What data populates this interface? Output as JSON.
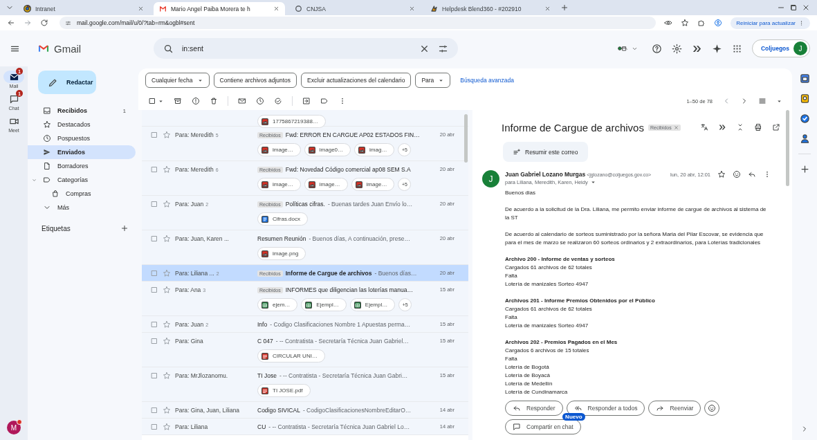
{
  "browser": {
    "tabs": [
      {
        "title": "Intranet",
        "kind": "tricolor",
        "selected": false
      },
      {
        "title": "Mario Angel Paiba Morera te h",
        "kind": "mail",
        "selected": true
      },
      {
        "title": "CNJSA",
        "kind": "ring",
        "selected": false
      },
      {
        "title": "Helpdesk Blend360 - #202910",
        "kind": "spark",
        "selected": false
      }
    ],
    "address": "mail.google.com/mail/u/0/?tab=rm&ogbl#sent",
    "update_button": "Reiniciar para actualizar"
  },
  "header": {
    "logo": "Gmail",
    "search": {
      "value": "in:sent"
    },
    "account": {
      "label": "Coljuegos",
      "initial": "J"
    }
  },
  "rail": [
    {
      "label": "Mail",
      "kind": "mail",
      "badge": "1",
      "selected": true
    },
    {
      "label": "Chat",
      "kind": "chat",
      "badge": "1",
      "selected": false
    },
    {
      "label": "Meet",
      "kind": "video",
      "selected": false
    }
  ],
  "profile": {
    "initial": "M"
  },
  "compose": "Redactar",
  "nav": [
    {
      "label": "Recibidos",
      "kind": "inbox",
      "count": "1",
      "unread": true,
      "selected": false
    },
    {
      "label": "Destacados",
      "kind": "star",
      "unread": false,
      "selected": false
    },
    {
      "label": "Pospuestos",
      "kind": "clock",
      "unread": false,
      "selected": false
    },
    {
      "label": "Enviados",
      "kind": "send",
      "unread": false,
      "selected": true
    },
    {
      "label": "Borradores",
      "kind": "file",
      "unread": false,
      "selected": false
    },
    {
      "label": "Categorías",
      "kind": "label",
      "unread": false,
      "selected": false,
      "expanded": true,
      "children": [
        {
          "label": "Compras",
          "kind": "bag",
          "unread": false,
          "selected": false
        }
      ]
    },
    {
      "label": "Más",
      "kind": "chevron",
      "unread": false,
      "selected": false
    }
  ],
  "labels_heading": "Etiquetas",
  "filters": {
    "chips": [
      {
        "label": "Cualquier fecha",
        "dropdown": true
      },
      {
        "label": "Contiene archivos adjuntos",
        "dropdown": false
      },
      {
        "label": "Excluir actualizaciones del calendario",
        "dropdown": false
      },
      {
        "label": "Para",
        "dropdown": true
      }
    ],
    "advanced_link": "Búsqueda avanzada"
  },
  "toolbar": {
    "select_all": {
      "checked": false
    },
    "pagination": "1–50 de 78"
  },
  "messages": [
    {
      "selected": false,
      "attachments": [
        {
          "name": "1775867219388…",
          "kind": "image"
        }
      ]
    },
    {
      "sender": "Para: Meredith",
      "count": "5",
      "label": "Recibidos",
      "subject": "Fwd: ERROR EN CARGUE AP02 ESTADOS FIN…",
      "date": "20 abr",
      "selected": false,
      "attachments": [
        {
          "name": "image…",
          "kind": "image"
        },
        {
          "name": "image0…",
          "kind": "image"
        },
        {
          "name": "imag…",
          "kind": "image"
        }
      ],
      "more": "+5"
    },
    {
      "sender": "Para: Meredith",
      "count": "6",
      "label": "Recibidos",
      "subject": "Fwd: Novedad Código comercial ap08 SEM S.A",
      "date": "20 abr",
      "selected": false,
      "attachments": [
        {
          "name": "image…",
          "kind": "image"
        },
        {
          "name": "image…",
          "kind": "image"
        },
        {
          "name": "image…",
          "kind": "image"
        }
      ],
      "more": "+5"
    },
    {
      "sender": "Para: Juan",
      "count": "2",
      "label": "Recibidos",
      "subject": "Políticas cifras.",
      "snippet": "- Buenas tardes Juan Envío lo…",
      "date": "20 abr",
      "selected": false,
      "attachments": [
        {
          "name": "Cifras.docx",
          "kind": "doc"
        }
      ]
    },
    {
      "sender": "Para: Juan, Karen ...",
      "subject": "Resumen Reunión",
      "snippet": "- Buenos días, A continuación, prese…",
      "date": "20 abr",
      "selected": false,
      "attachments": [
        {
          "name": "image.png",
          "kind": "image"
        }
      ]
    },
    {
      "sender": "Para: Liliana ...",
      "count": "2",
      "label": "Recibidos",
      "subject": "Informe de Cargue de archivos",
      "snippet": "- Buenos días…",
      "date": "20 abr",
      "selected": true
    },
    {
      "sender": "Para: Ana",
      "count": "3",
      "label": "Recibidos",
      "subject": "INFORMES que diligencian las loterías manua…",
      "date": "15 abr",
      "selected": false,
      "attachments": [
        {
          "name": "ejem…",
          "kind": "sheet"
        },
        {
          "name": "Ejempl…",
          "kind": "sheet"
        },
        {
          "name": "Ejempl…",
          "kind": "sheet"
        }
      ],
      "more": "+5"
    },
    {
      "sender": "Para: Juan",
      "count": "2",
      "subject": "Info",
      "snippet": "- Codigo Clasificaciones Nombre 1 Apuestas perma…",
      "date": "15 abr",
      "selected": false
    },
    {
      "sender": "Para: Gina",
      "subject": "C 047",
      "snippet": "- -- Contratista - Secretaría Técnica Juan Gabriel…",
      "date": "15 abr",
      "selected": false,
      "attachments": [
        {
          "name": "CIRCULAR UNI…",
          "kind": "pdf"
        }
      ]
    },
    {
      "sender": "Para: MrJlozanomu.",
      "subject": "TI Jose",
      "snippet": "- -- Contratista - Secretaría Técnica Juan Gabri…",
      "date": "15 abr",
      "selected": false,
      "attachments": [
        {
          "name": "TI JOSE.pdf",
          "kind": "pdf"
        }
      ]
    },
    {
      "sender": "Para: Gina, Juan, Liliana",
      "subject": "Codigo SIVICAL",
      "snippet": "- CodigoClasificacionesNombreEditarO…",
      "date": "14 abr",
      "selected": false
    },
    {
      "sender": "Para: Liliana",
      "subject": "CU",
      "snippet": "- -- Contratista - Secretaría Técnica Juan Gabriel Lo…",
      "date": "14 abr",
      "selected": false
    }
  ],
  "reading_pane": {
    "subject": "Informe de Cargue de archivos",
    "label": "Recibidos",
    "summarize": "Resumir este correo",
    "sender": {
      "initial": "J",
      "name": "Juan Gabriel Lozano Murgas",
      "email": "<jglozano@coljuegos.gov.co>",
      "date": "lun, 20 abr, 12:01",
      "to": "para Liliana, Meredith, Karen, Heidy"
    },
    "body": [
      {
        "kind": "paragraph",
        "text": "Buenos dias"
      },
      {
        "kind": "paragraph",
        "text": "De acuerdo a la solicitud de la Dra. Liliana, me permito enviar informe de cargue de archivos al sistema de la ST"
      },
      {
        "kind": "paragraph",
        "text": "De acuerdo al calendario de sorteos suministrado por la señora Maria del Pilar Escovar, se evidencia que para el mes de marzo se realizaron 60 sorteos ordinarios y 2 extraordinarios, para Loterías tradicionales"
      },
      {
        "kind": "section",
        "title": "Archivo 200 - Informe de ventas y sorteos",
        "lines": [
          "Cargados 61 archivos de 62 totales",
          "Falta",
          "Lotería de manizales Sorteo 4947"
        ]
      },
      {
        "kind": "section",
        "title": "Archivos 201 - Informe Premios Obtenidos por el Público",
        "lines": [
          "Cargados 61 archivos de 62 totales",
          "Falta",
          "Lotería de manizales Sorteo 4947"
        ]
      },
      {
        "kind": "section",
        "title": "Archivos 202 - Premios Pagados en el Mes",
        "lines": [
          "Cargados 6 archivos de 15 totales",
          "Falta",
          "Lotería de Bogotá",
          "Lotería de Boyacá",
          "Lotería de Medellín",
          "Lotería de Cundinamarca"
        ]
      }
    ],
    "actions": [
      {
        "label": "Responder",
        "kind": "reply"
      },
      {
        "label": "Responder a todos",
        "kind": "reply_all"
      },
      {
        "label": "Reenviar",
        "kind": "forward"
      }
    ],
    "share": {
      "label": "Compartir en chat",
      "badge": "Nuevo"
    }
  }
}
